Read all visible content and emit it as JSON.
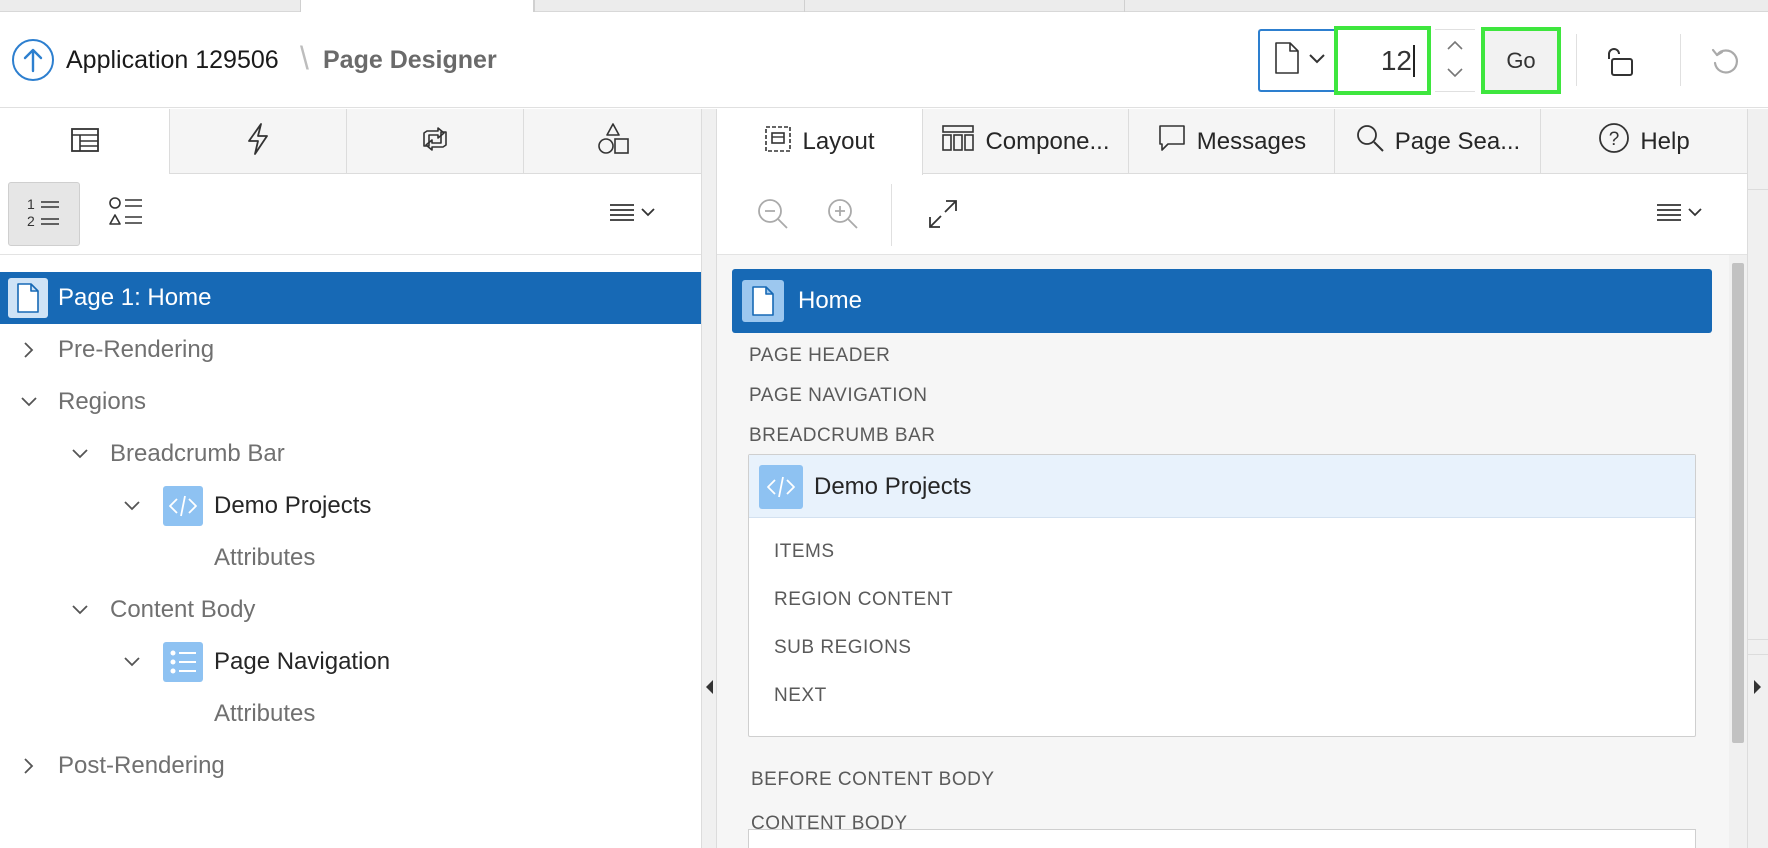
{
  "header": {
    "app_title": "Application 129506",
    "separator": "\\",
    "page_designer": "Page Designer",
    "page_number": "12",
    "go_label": "Go"
  },
  "left_tabs": [
    {
      "icon": "rendering-tree-icon"
    },
    {
      "icon": "dynamic-actions-icon"
    },
    {
      "icon": "processing-icon"
    },
    {
      "icon": "shared-components-icon"
    }
  ],
  "tree": {
    "page": "Page 1: Home",
    "pre_rendering": "Pre-Rendering",
    "regions": "Regions",
    "breadcrumb_bar": "Breadcrumb Bar",
    "demo_projects": "Demo Projects",
    "attributes_1": "Attributes",
    "content_body": "Content Body",
    "page_navigation": "Page Navigation",
    "attributes_2": "Attributes",
    "post_rendering": "Post-Rendering"
  },
  "right_tabs": {
    "layout": "Layout",
    "components": "Compone...",
    "messages": "Messages",
    "page_search": "Page Sea...",
    "help": "Help"
  },
  "canvas": {
    "home": "Home",
    "page_header": "PAGE HEADER",
    "page_navigation": "PAGE NAVIGATION",
    "breadcrumb_bar": "BREADCRUMB BAR",
    "region_title": "Demo Projects",
    "items": "ITEMS",
    "region_content": "REGION CONTENT",
    "sub_regions": "SUB REGIONS",
    "next": "NEXT",
    "before_content_body": "BEFORE CONTENT BODY",
    "content_body": "CONTENT BODY"
  },
  "colors": {
    "selected": "#1769b5",
    "highlight": "#3ee63e",
    "accent": "#2d7fcf"
  }
}
